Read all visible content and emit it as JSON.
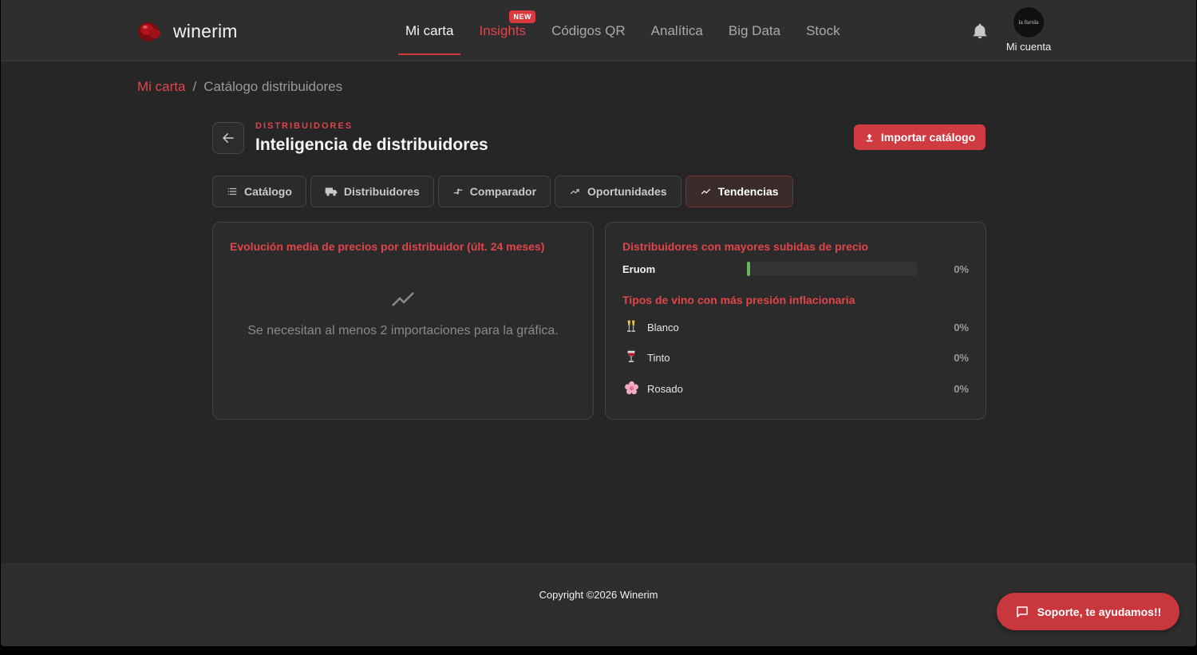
{
  "brand": {
    "name": "winerim"
  },
  "nav": {
    "items": [
      {
        "label": "Mi carta",
        "active": true
      },
      {
        "label": "Insights",
        "badge": "NEW"
      },
      {
        "label": "Códigos QR"
      },
      {
        "label": "Analítica"
      },
      {
        "label": "Big Data"
      },
      {
        "label": "Stock"
      }
    ]
  },
  "account": {
    "label": "Mi cuenta",
    "avatar_text": "la farola"
  },
  "breadcrumb": {
    "root": "Mi carta",
    "separator": "/",
    "current": "Catálogo distribuidores"
  },
  "header": {
    "eyebrow": "DISTRIBUIDORES",
    "title": "Inteligencia de distribuidores",
    "import_label": "Importar catálogo"
  },
  "tabs": [
    {
      "label": "Catálogo",
      "icon": "list-icon"
    },
    {
      "label": "Distribuidores",
      "icon": "truck-icon"
    },
    {
      "label": "Comparador",
      "icon": "compare-arrows-icon"
    },
    {
      "label": "Oportunidades",
      "icon": "trending-up-icon"
    },
    {
      "label": "Tendencias",
      "icon": "trend-line-icon",
      "active": true
    }
  ],
  "price_evolution": {
    "title": "Evolución media de precios por distribuidor (últ. 24 meses)",
    "empty_message": "Se necesitan al menos 2 importaciones para la gráfica."
  },
  "top_increases": {
    "title": "Distribuidores con mayores subidas de precio",
    "rows": [
      {
        "name": "Eruom",
        "pct": "0%",
        "fill": 0.0
      }
    ]
  },
  "wine_pressure": {
    "title": "Tipos de vino con más presión inflacionaria",
    "rows": [
      {
        "name": "Blanco",
        "pct": "0%",
        "icon": "champagne-glasses-icon"
      },
      {
        "name": "Tinto",
        "pct": "0%",
        "icon": "wine-glass-icon"
      },
      {
        "name": "Rosado",
        "pct": "0%",
        "icon": "cherry-blossom-icon"
      }
    ]
  },
  "footer": {
    "copyright": "Copyright ©2026 Winerim"
  },
  "support": {
    "label": "Soporte, te ayudamos!!"
  },
  "colors": {
    "accent": "#d83a3f",
    "background": "#262626",
    "bar_fill": "#5fb95c"
  }
}
